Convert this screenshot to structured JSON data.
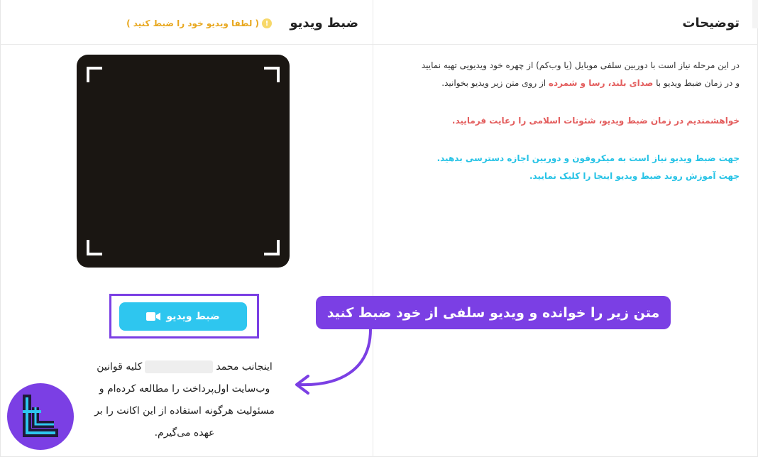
{
  "description_panel": {
    "title": "توضیحات",
    "line1": "در این مرحله نیاز است با دوربین سلفی موبایل (یا وب‌کم) از چهره خود ویدیویی تهیه نمایید",
    "line2_prefix": "و در زمان ضبط ویدیو با",
    "line2_highlight": "صدای بلند، رسا و شمرده",
    "line2_suffix": "از روی متن زیر ویدیو بخوانید.",
    "warning_line": "خواهشمندیم در زمان ضبط ویدیو، شئونات اسلامی را رعایت فرمایید.",
    "permission_line": "جهت ضبط ویدیو نیاز است به میکروفون و دوربین اجازه دسترسی بدهید.",
    "tutorial_line": "جهت آموزش روند ضبط ویدیو اینجا را کلیک نمایید."
  },
  "record_panel": {
    "title": "ضبط ویدیو",
    "hint": "( لطفا ویدیو خود را ضبط کنید )",
    "hint_icon": "!",
    "record_button_label": "ضبط ویدیو",
    "commitment": {
      "line1_prefix": "اینجانب محمد",
      "line1_suffix": "کلیه قوانین",
      "line2": "وب‌سایت اول‌پرداخت را مطالعه کرده‌ام و",
      "line3": "مسئولیت هرگونه استفاده از این اکانت را بر",
      "line4": "عهده می‌گیرم."
    }
  },
  "annotation": {
    "callout_text": "متن زیر را خوانده و ویدیو سلفی از خود ضبط کنید"
  },
  "colors": {
    "accent_purple": "#7b3fe4",
    "button_cyan": "#2ec6ef",
    "hint_orange": "#e8a820",
    "highlight_red": "#e35d5d",
    "info_cyan": "#27c3e6"
  }
}
